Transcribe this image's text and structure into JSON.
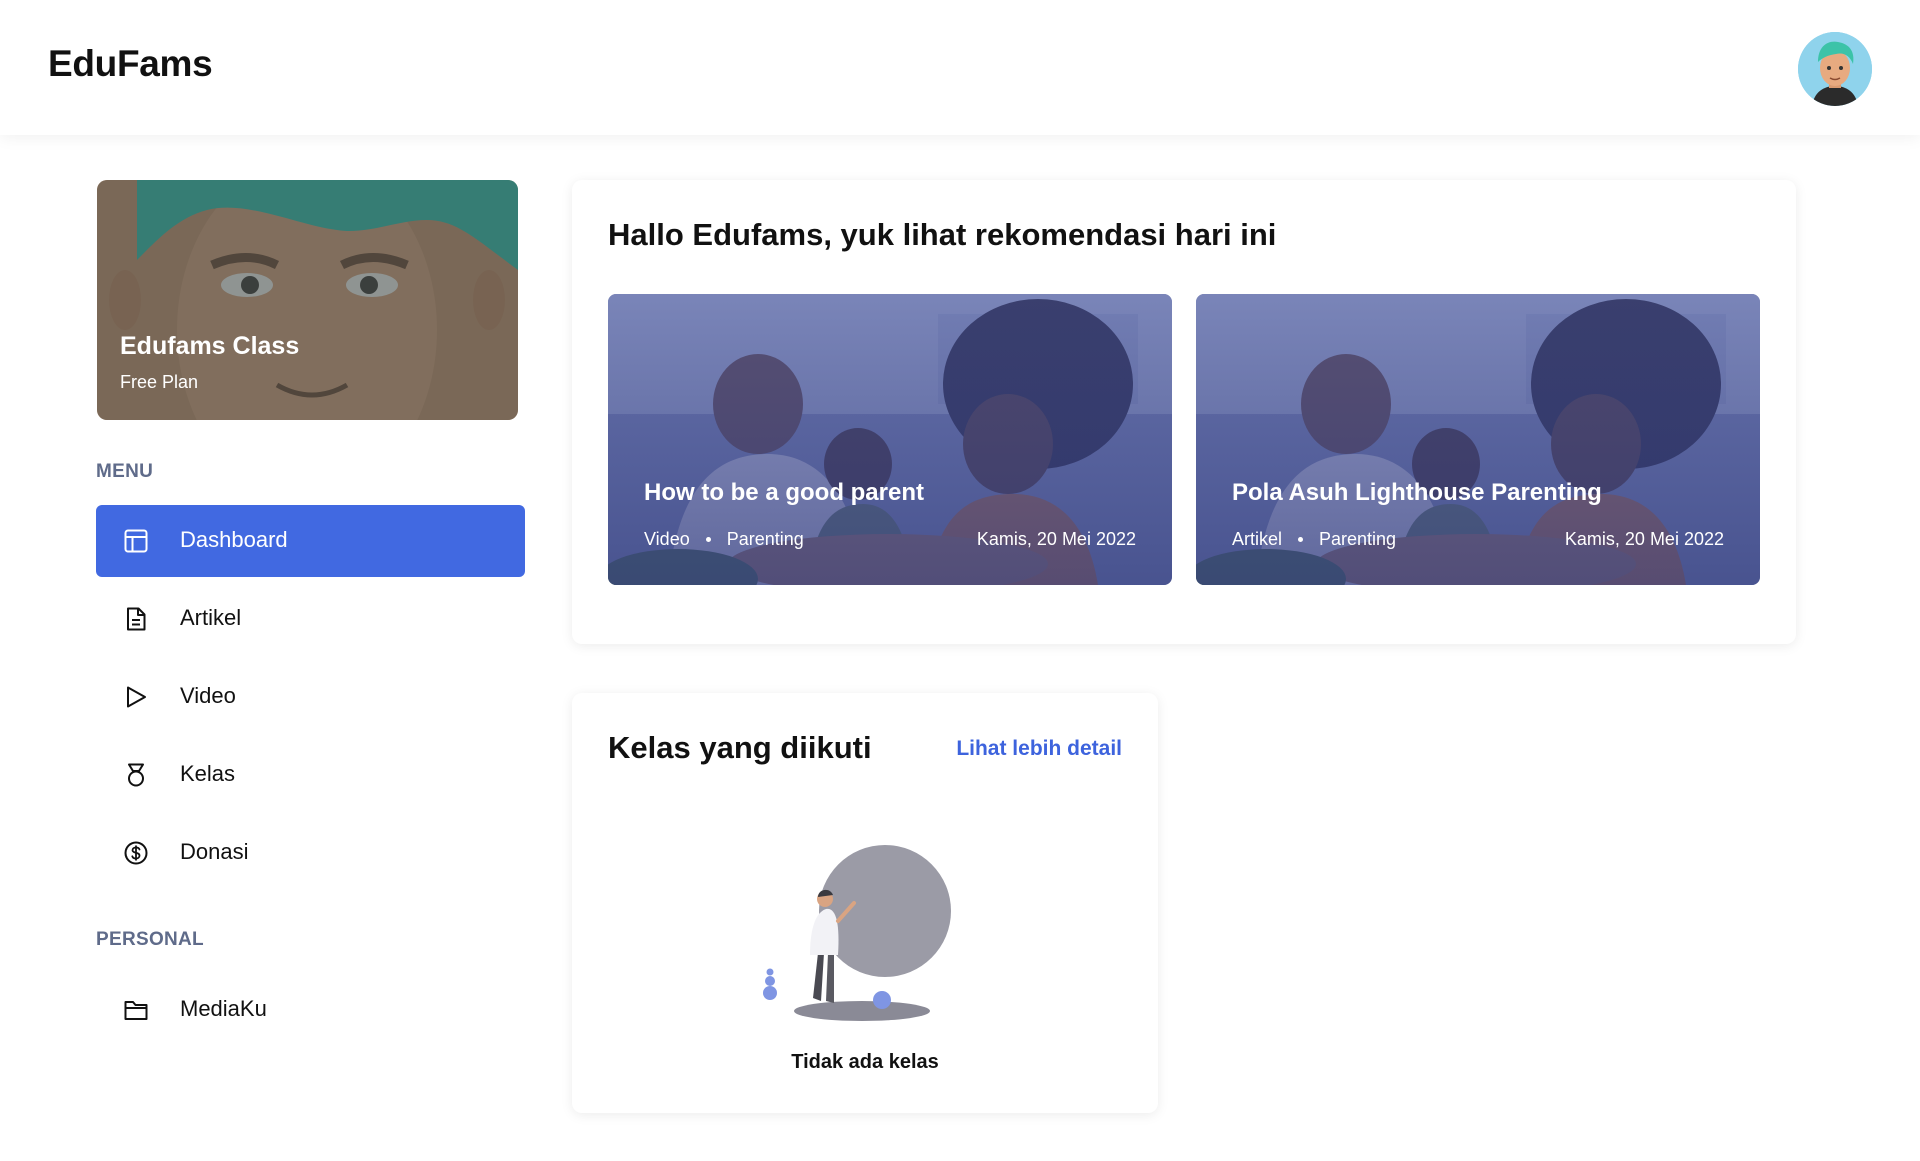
{
  "header": {
    "brand": "EduFams",
    "avatar_icon": "user-avatar-icon"
  },
  "sidebar": {
    "profile": {
      "name": "Edufams Class",
      "plan": "Free Plan"
    },
    "menu_label": "MENU",
    "menu_items": [
      {
        "label": "Dashboard",
        "icon": "layout-icon",
        "active": true
      },
      {
        "label": "Artikel",
        "icon": "document-icon",
        "active": false
      },
      {
        "label": "Video",
        "icon": "play-icon",
        "active": false
      },
      {
        "label": "Kelas",
        "icon": "medal-icon",
        "active": false
      },
      {
        "label": "Donasi",
        "icon": "dollar-circle-icon",
        "active": false
      }
    ],
    "personal_label": "PERSONAL",
    "personal_items": [
      {
        "label": "MediaKu",
        "icon": "folder-icon",
        "active": false
      }
    ]
  },
  "recommendations": {
    "title": "Hallo Edufams, yuk lihat rekomendasi hari ini",
    "cards": [
      {
        "title": "How to be a good parent",
        "type": "Video",
        "category": "Parenting",
        "date": "Kamis, 20 Mei 2022"
      },
      {
        "title": "Pola Asuh Lighthouse Parenting",
        "type": "Artikel",
        "category": "Parenting",
        "date": "Kamis, 20 Mei 2022"
      }
    ]
  },
  "classes": {
    "title": "Kelas yang diikuti",
    "link": "Lihat lebih detail",
    "empty_text": "Tidak ada kelas"
  },
  "colors": {
    "accent": "#4169e1",
    "link": "#3d63dd",
    "section_label": "#5f6b8a"
  }
}
